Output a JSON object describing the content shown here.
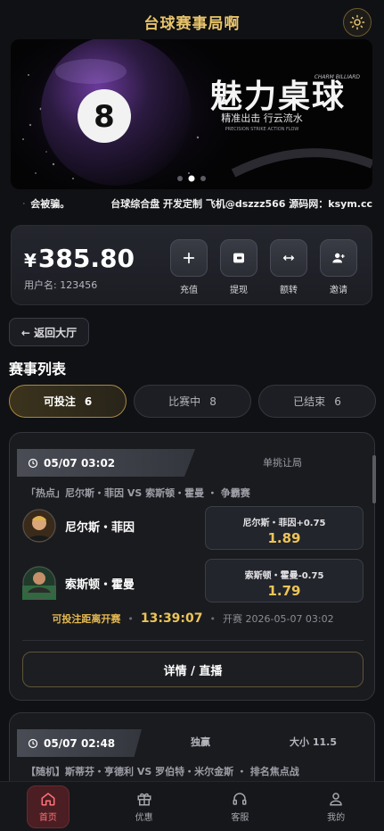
{
  "app": {
    "title": "台球赛事局啊"
  },
  "banner": {
    "ball_number": "8",
    "headline": "魅力桌球",
    "tag_top": "CHARM BILLIARD",
    "slogan": "精准出击 行云流水",
    "slogan_sub": "PRECISION STRIKE ACTION FLOW"
  },
  "ticker": {
    "segment1": "会被骗。",
    "segment2": "台球综合盘 开发定制 飞机@dszzz566 源码网：ksym.cc"
  },
  "wallet": {
    "currency": "¥",
    "balance": "385.80",
    "username_label": "用户名:",
    "username": "123456",
    "actions": [
      {
        "label": "充值",
        "icon": "plus-icon"
      },
      {
        "label": "提现",
        "icon": "withdraw-icon"
      },
      {
        "label": "额转",
        "icon": "transfer-icon"
      },
      {
        "label": "邀请",
        "icon": "invite-user-icon"
      }
    ]
  },
  "nav": {
    "back_label": "← 返回大厅"
  },
  "section": {
    "title": "赛事列表"
  },
  "tabs": [
    {
      "label": "可投注",
      "count": "6",
      "active": true
    },
    {
      "label": "比赛中",
      "count": "8",
      "active": false
    },
    {
      "label": "已结束",
      "count": "6",
      "active": false
    }
  ],
  "matches": [
    {
      "time": "05/07 03:02",
      "market": "单挑让局",
      "title": "「热点」尼尔斯・菲因 VS 索斯顿・霍曼 ・ 争霸赛",
      "players": [
        {
          "name": "尼尔斯・菲因",
          "odds_label": "尼尔斯・菲因+0.75",
          "odds": "1.89"
        },
        {
          "name": "索斯顿・霍曼",
          "odds_label": "索斯顿・霍曼-0.75",
          "odds": "1.79"
        }
      ],
      "countdown_label": "可投注距离开赛",
      "countdown": "13:39:07",
      "start_text": "开赛 2026-05-07 03:02",
      "detail_label": "详情 / 直播"
    },
    {
      "time": "05/07 02:48",
      "market1": "独赢",
      "market2": "大小 11.5",
      "title": "【随机】斯蒂芬・亨德利 VS 罗伯特・米尔金斯 ・ 排名焦点战"
    }
  ],
  "bottom_nav": [
    {
      "label": "首页",
      "icon": "home-icon",
      "active": true
    },
    {
      "label": "优惠",
      "icon": "gift-icon",
      "active": false
    },
    {
      "label": "客服",
      "icon": "headset-icon",
      "active": false
    },
    {
      "label": "我的",
      "icon": "profile-icon",
      "active": false
    }
  ],
  "colors": {
    "accent_gold": "#ecc458",
    "background": "#101114",
    "active_nav": "#ff7179"
  }
}
